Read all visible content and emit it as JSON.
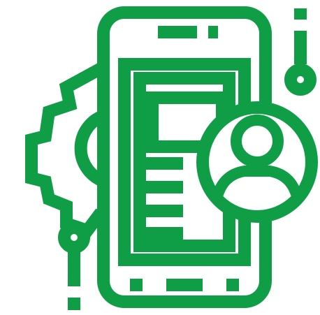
{
  "icon": {
    "name": "mobile-app-user-settings",
    "color": "#0f9d45",
    "background": "#ffffff",
    "parts": [
      "phone-icon",
      "gear-icon",
      "user-avatar-icon",
      "document-lines-icon",
      "connector-lines-icon"
    ]
  }
}
